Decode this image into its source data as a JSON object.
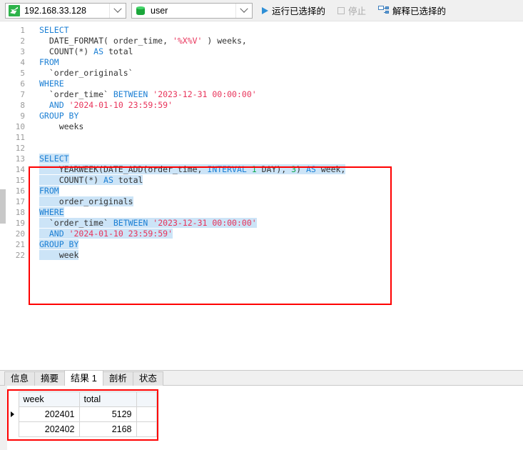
{
  "toolbar": {
    "connection": {
      "label": "192.168.33.128",
      "icon": "mysql-dolphin-icon"
    },
    "database": {
      "label": "user",
      "icon": "database-cylinder-icon"
    },
    "run_selected": {
      "label": "运行已选择的",
      "icon": "play-icon"
    },
    "stop": {
      "label": "停止",
      "icon": "stop-icon",
      "disabled": true
    },
    "explain_selected": {
      "label": "解释已选择的",
      "icon": "explain-plan-icon"
    }
  },
  "editor": {
    "lines": [
      {
        "n": "1",
        "tokens": [
          {
            "t": "SELECT",
            "c": "kw"
          }
        ],
        "indent": 0
      },
      {
        "n": "2",
        "tokens": [
          {
            "t": "  DATE_FORMAT( order_time, ",
            "c": "pl"
          },
          {
            "t": "'%X%V'",
            "c": "str"
          },
          {
            "t": " ) weeks,",
            "c": "pl"
          }
        ]
      },
      {
        "n": "3",
        "tokens": [
          {
            "t": "  COUNT(*) ",
            "c": "pl"
          },
          {
            "t": "AS",
            "c": "kw"
          },
          {
            "t": " total",
            "c": "pl"
          }
        ]
      },
      {
        "n": "4",
        "tokens": [
          {
            "t": "FROM",
            "c": "kw"
          }
        ]
      },
      {
        "n": "5",
        "tokens": [
          {
            "t": "  `order_originals`",
            "c": "pl"
          }
        ]
      },
      {
        "n": "6",
        "tokens": [
          {
            "t": "WHERE",
            "c": "kw"
          }
        ]
      },
      {
        "n": "7",
        "tokens": [
          {
            "t": "  `order_time` ",
            "c": "pl"
          },
          {
            "t": "BETWEEN",
            "c": "kw"
          },
          {
            "t": " ",
            "c": "pl"
          },
          {
            "t": "'2023-12-31 00:00:00'",
            "c": "str"
          }
        ]
      },
      {
        "n": "8",
        "tokens": [
          {
            "t": "  ",
            "c": "pl"
          },
          {
            "t": "AND",
            "c": "kw"
          },
          {
            "t": " ",
            "c": "pl"
          },
          {
            "t": "'2024-01-10 23:59:59'",
            "c": "str"
          }
        ]
      },
      {
        "n": "9",
        "tokens": [
          {
            "t": "GROUP BY",
            "c": "kw"
          }
        ]
      },
      {
        "n": "10",
        "tokens": [
          {
            "t": "    weeks",
            "c": "pl"
          }
        ]
      },
      {
        "n": "11",
        "tokens": []
      },
      {
        "n": "12",
        "tokens": []
      },
      {
        "n": "13",
        "tokens": [
          {
            "t": "SELECT",
            "c": "kw"
          }
        ],
        "selected": true
      },
      {
        "n": "14",
        "tokens": [
          {
            "t": "    YEARWEEK(DATE_ADD(order_time, ",
            "c": "pl"
          },
          {
            "t": "INTERVAL",
            "c": "kw"
          },
          {
            "t": " ",
            "c": "pl"
          },
          {
            "t": "1",
            "c": "num"
          },
          {
            "t": " DAY), ",
            "c": "pl"
          },
          {
            "t": "3",
            "c": "num"
          },
          {
            "t": ") ",
            "c": "pl"
          },
          {
            "t": "AS",
            "c": "kw"
          },
          {
            "t": " week,",
            "c": "pl"
          }
        ],
        "selected": true
      },
      {
        "n": "15",
        "tokens": [
          {
            "t": "    COUNT(*) ",
            "c": "pl"
          },
          {
            "t": "AS",
            "c": "kw"
          },
          {
            "t": " total",
            "c": "pl"
          }
        ],
        "selected": true
      },
      {
        "n": "16",
        "tokens": [
          {
            "t": "FROM",
            "c": "kw"
          }
        ],
        "selected": true
      },
      {
        "n": "17",
        "tokens": [
          {
            "t": "    order_originals",
            "c": "pl"
          }
        ],
        "selected": true
      },
      {
        "n": "18",
        "tokens": [
          {
            "t": "WHERE",
            "c": "kw"
          }
        ],
        "selected": true
      },
      {
        "n": "19",
        "tokens": [
          {
            "t": "  `order_time` ",
            "c": "pl"
          },
          {
            "t": "BETWEEN",
            "c": "kw"
          },
          {
            "t": " ",
            "c": "pl"
          },
          {
            "t": "'2023-12-31 00:00:00'",
            "c": "str"
          }
        ],
        "selected": true
      },
      {
        "n": "20",
        "tokens": [
          {
            "t": "  ",
            "c": "pl"
          },
          {
            "t": "AND",
            "c": "kw"
          },
          {
            "t": " ",
            "c": "pl"
          },
          {
            "t": "'2024-01-10 23:59:59'",
            "c": "str"
          }
        ],
        "selected": true
      },
      {
        "n": "21",
        "tokens": [
          {
            "t": "GROUP BY",
            "c": "kw"
          }
        ],
        "selected": true
      },
      {
        "n": "22",
        "tokens": [
          {
            "t": "    week",
            "c": "pl"
          }
        ],
        "selected": true
      }
    ]
  },
  "bottom_tabs": [
    {
      "label": "信息",
      "active": false
    },
    {
      "label": "摘要",
      "active": false
    },
    {
      "label": "结果 1",
      "active": true
    },
    {
      "label": "剖析",
      "active": false
    },
    {
      "label": "状态",
      "active": false
    }
  ],
  "result_grid": {
    "columns": [
      "week",
      "total"
    ],
    "rows": [
      {
        "selected": true,
        "cells": [
          "202401",
          "5129"
        ]
      },
      {
        "selected": false,
        "cells": [
          "202402",
          "2168"
        ]
      }
    ]
  },
  "annotations": {
    "editor_highlight_color": "#ff0000",
    "grid_highlight_color": "#ff0000",
    "selection_color": "#cce4f7"
  }
}
